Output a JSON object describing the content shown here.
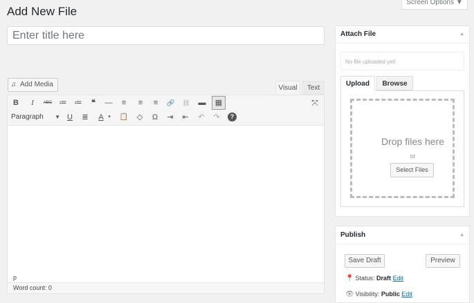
{
  "page": {
    "title": "Add New File",
    "screen_options": "Screen Options ▼"
  },
  "title_field": {
    "placeholder": "Enter title here",
    "value": ""
  },
  "editor": {
    "add_media_label": "Add Media",
    "tab_visual": "Visual",
    "tab_text": "Text",
    "format_select": "Paragraph",
    "path": "p",
    "word_count": "Word count: 0",
    "toolbar_row1": [
      "B",
      "I",
      "ABC",
      "≔",
      "≔",
      "❝",
      "—",
      "≡",
      "≡",
      "≡",
      "🔗",
      "⛓",
      "▬",
      "▦"
    ],
    "toolbar_row2": [
      "U",
      "≣",
      "A",
      "📋",
      "◇",
      "Ω",
      "⇥",
      "⇤",
      "↶",
      "↷",
      "?"
    ]
  },
  "attach_file": {
    "heading": "Attach File",
    "no_file_text": "No file uploaded yet!",
    "tab_upload": "Upload",
    "tab_browse": "Browse",
    "drop_text": "Drop files here",
    "or_text": "or",
    "select_files_label": "Select Files"
  },
  "publish": {
    "heading": "Publish",
    "save_draft_label": "Save Draft",
    "preview_label": "Preview",
    "status_label": "Status:",
    "status_value": "Draft",
    "visibility_label": "Visibility:",
    "visibility_value": "Public",
    "edit_link": "Edit"
  },
  "colors": {
    "link": "#0073aa",
    "background": "#f1f1f1",
    "accent": "#23282d"
  }
}
